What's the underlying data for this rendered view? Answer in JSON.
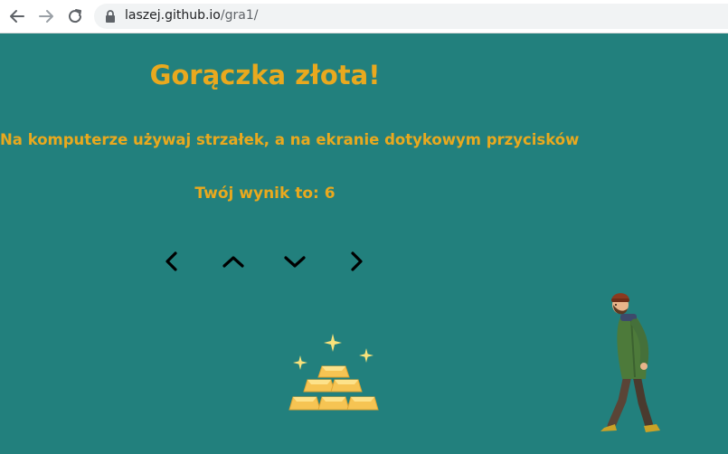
{
  "browser": {
    "url_host": "laszej.github.io",
    "url_path": "/gra1/",
    "back_icon": "arrow-left-icon",
    "forward_icon": "arrow-right-icon",
    "reload_icon": "reload-icon",
    "lock_icon": "lock-icon"
  },
  "game": {
    "title": "Gorączka złota!",
    "instructions": "Na komputerze używaj strzałek, a na ekranie dotykowym przycisków",
    "score_text": "Twój wynik to: 6",
    "controls": [
      {
        "name": "left",
        "icon": "chevron-left-icon"
      },
      {
        "name": "up",
        "icon": "chevron-up-icon"
      },
      {
        "name": "down",
        "icon": "chevron-down-icon"
      },
      {
        "name": "right",
        "icon": "chevron-right-icon"
      }
    ],
    "gold_icon": "gold-bars-icon",
    "player_icon": "walking-man-icon"
  },
  "colors": {
    "background": "#22807d",
    "text": "#e9a91e",
    "gold": "#f6c453",
    "sparkle": "#f9e27a"
  }
}
